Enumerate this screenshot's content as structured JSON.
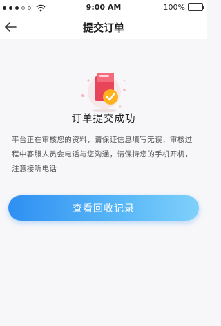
{
  "status_bar": {
    "time": "9:00 AM",
    "battery": "100%"
  },
  "nav": {
    "title": "提交订单"
  },
  "result": {
    "title": "订单提交成功",
    "description": "平台正在审核您的资料，请保证信息填写无误，审核过程中客服人员会电话与您沟通，请保持您的手机开机，注意接听电话"
  },
  "actions": {
    "view_records_label": "查看回收记录"
  },
  "colors": {
    "button_start": "#2f8ff2",
    "button_end": "#7fd0fb",
    "icon_primary": "#e8455a",
    "icon_accent": "#ffb21e"
  }
}
